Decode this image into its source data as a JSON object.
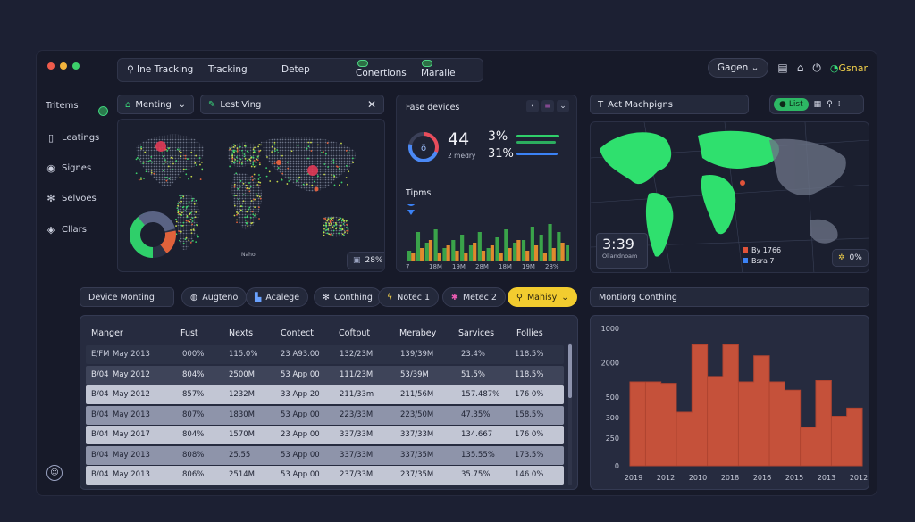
{
  "topnav": {
    "tabs": [
      {
        "label": "Ine Tracking",
        "icon": "pin-icon"
      },
      {
        "label": "Tracking"
      },
      {
        "label": "Detep"
      },
      {
        "label": "Conertions",
        "switch": "on"
      },
      {
        "label": "Maralle",
        "switch": "on"
      }
    ]
  },
  "header": {
    "user_button": "Gagen",
    "brand": "Gsnar"
  },
  "sidebar": {
    "items": [
      {
        "label": "Tritems",
        "icon": ""
      },
      {
        "label": "Leatings",
        "icon": "document-icon"
      },
      {
        "label": "Signes",
        "icon": "signal-icon"
      },
      {
        "label": "Selvoes",
        "icon": "gear-icon"
      },
      {
        "label": "Cllars",
        "icon": "tag-icon"
      }
    ]
  },
  "map_panel": {
    "dropdown": "Menting",
    "search_value": "Lest Ving",
    "badge": "28%",
    "caption": "Naho"
  },
  "devices_panel": {
    "title": "Fase devices",
    "ring_value": "ö",
    "kpi_main": "44",
    "kpi_sub": "2 medry",
    "pct1": "3%",
    "pct2": "31%",
    "tipms_label": "Tipms",
    "x_labels": [
      "7",
      "18M",
      "19M",
      "28M",
      "18M",
      "19M",
      "28%"
    ]
  },
  "right_map": {
    "title": "Act Machpigns",
    "toggle_label": "List",
    "time": "3:39",
    "time_caption": "Ollandnoam",
    "legend": [
      {
        "label": "By 1766",
        "color": "#e0533a"
      },
      {
        "label": "Bsra 7",
        "color": "#3b82f6"
      }
    ],
    "badge": "0%"
  },
  "filters": {
    "device_monitoring": "Device Monting",
    "chips": [
      {
        "label": "Augteno",
        "icon": "globe-icon"
      },
      {
        "label": "Acalege",
        "icon": "chart-icon"
      },
      {
        "label": "Conthing",
        "icon": "gear-icon"
      },
      {
        "label": "Notec 1",
        "icon": "bolt-icon"
      },
      {
        "label": "Metec 2",
        "icon": "star-icon"
      },
      {
        "label": "Mahisy",
        "icon": "search-icon"
      }
    ]
  },
  "monitoring_title": "Montiorg Conthing",
  "table": {
    "headers": [
      "Manger",
      "Fust",
      "Nexts",
      "Contect",
      "Coftput",
      "Merabey",
      "Sarvices",
      "Follies"
    ],
    "rows": [
      [
        "E/FM",
        "May 2013",
        "000%",
        "115.0%",
        "23 A93.00",
        "132/23M",
        "139/39M",
        "23.4%",
        "118.5%"
      ],
      [
        "B/04",
        "May 2012",
        "804%",
        "2500M",
        "53 App 00",
        "111/23M",
        "53/39M",
        "51.5%",
        "118.5%"
      ],
      [
        "B/04",
        "May 2012",
        "857%",
        "1232M",
        "33 App 20",
        "211/33m",
        "211/56M",
        "157.487%",
        "176 0%"
      ],
      [
        "B/04",
        "May 2013",
        "807%",
        "1830M",
        "53 App 00",
        "223/33M",
        "223/50M",
        "47.35%",
        "158.5%"
      ],
      [
        "B/04",
        "May 2017",
        "804%",
        "1570M",
        "23 App 00",
        "337/33M",
        "337/33M",
        "134.667",
        "176 0%"
      ],
      [
        "B/04",
        "May 2013",
        "808%",
        "25.55",
        "53 App 00",
        "337/33M",
        "337/35M",
        "135.55%",
        "173.5%"
      ],
      [
        "B/04",
        "May 2013",
        "806%",
        "2514M",
        "53 App 00",
        "237/33M",
        "237/35M",
        "35.75%",
        "146 0%"
      ]
    ]
  },
  "chart_data": [
    {
      "type": "bar",
      "title": "Tipms",
      "x": [
        "7",
        "18M",
        "19M",
        "28M",
        "18M",
        "19M",
        "28%"
      ],
      "series": [
        {
          "color": "#3aa34a",
          "values": [
            20,
            55,
            35,
            60,
            25,
            40,
            50,
            30,
            55,
            25,
            45,
            60,
            35,
            40,
            65,
            50,
            70,
            55,
            30,
            62,
            68,
            40
          ]
        },
        {
          "color": "#e08a2e",
          "values": [
            15,
            25,
            40,
            15,
            30,
            20,
            15,
            35,
            20,
            30,
            15,
            25,
            40,
            20,
            30,
            15,
            25,
            35,
            20,
            25,
            15,
            30
          ]
        }
      ]
    },
    {
      "type": "area",
      "title": "Montiorg Conthing",
      "x": [
        "2019",
        "2012",
        "2010",
        "2018",
        "2016",
        "2015",
        "2013",
        "2012"
      ],
      "ylim": [
        0,
        1000
      ],
      "yticks": [
        0,
        250,
        300,
        500,
        2000,
        1000
      ],
      "ytick_labels": [
        "0",
        "250",
        "300",
        "500",
        "2000",
        "1000"
      ],
      "values": [
        610,
        610,
        600,
        390,
        880,
        650,
        880,
        610,
        800,
        610,
        550,
        280,
        620,
        360,
        420,
        380
      ],
      "color": "#d2553a"
    }
  ]
}
